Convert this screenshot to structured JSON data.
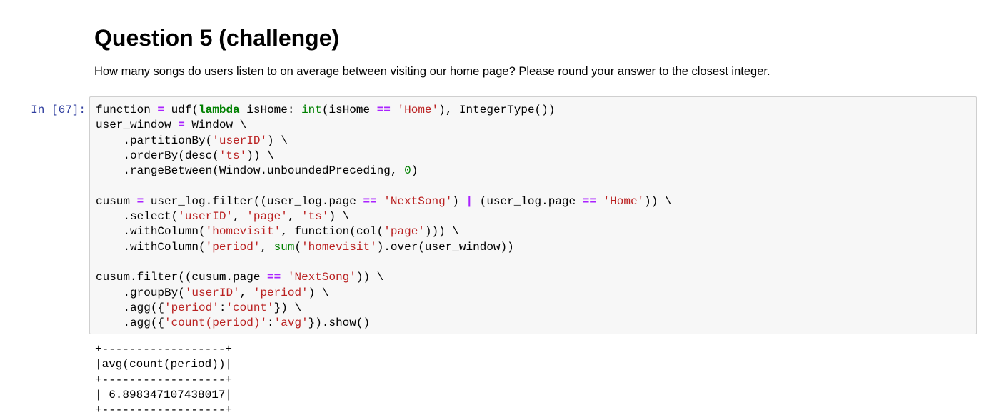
{
  "heading": "Question 5 (challenge)",
  "description": "How many songs do users listen to on average between visiting our home page? Please round your answer to the closest integer.",
  "cell": {
    "prompt": "In [67]:",
    "code_lines": [
      [
        [
          "t",
          "function "
        ],
        [
          "o",
          "="
        ],
        [
          "t",
          " udf("
        ],
        [
          "k",
          "lambda"
        ],
        [
          "t",
          " isHome: "
        ],
        [
          "b",
          "int"
        ],
        [
          "t",
          "(isHome "
        ],
        [
          "o",
          "=="
        ],
        [
          "t",
          " "
        ],
        [
          "s",
          "'Home'"
        ],
        [
          "t",
          "), IntegerType())"
        ]
      ],
      [
        [
          "t",
          "user_window "
        ],
        [
          "o",
          "="
        ],
        [
          "t",
          " Window \\"
        ]
      ],
      [
        [
          "t",
          "    .partitionBy("
        ],
        [
          "s",
          "'userID'"
        ],
        [
          "t",
          ") \\"
        ]
      ],
      [
        [
          "t",
          "    .orderBy(desc("
        ],
        [
          "s",
          "'ts'"
        ],
        [
          "t",
          ")) \\"
        ]
      ],
      [
        [
          "t",
          "    .rangeBetween(Window.unboundedPreceding, "
        ],
        [
          "n",
          "0"
        ],
        [
          "t",
          ")"
        ]
      ],
      [],
      [
        [
          "t",
          "cusum "
        ],
        [
          "o",
          "="
        ],
        [
          "t",
          " user_log.filter((user_log.page "
        ],
        [
          "o",
          "=="
        ],
        [
          "t",
          " "
        ],
        [
          "s",
          "'NextSong'"
        ],
        [
          "t",
          ") "
        ],
        [
          "o",
          "|"
        ],
        [
          "t",
          " (user_log.page "
        ],
        [
          "o",
          "=="
        ],
        [
          "t",
          " "
        ],
        [
          "s",
          "'Home'"
        ],
        [
          "t",
          ")) \\"
        ]
      ],
      [
        [
          "t",
          "    .select("
        ],
        [
          "s",
          "'userID'"
        ],
        [
          "t",
          ", "
        ],
        [
          "s",
          "'page'"
        ],
        [
          "t",
          ", "
        ],
        [
          "s",
          "'ts'"
        ],
        [
          "t",
          ") \\"
        ]
      ],
      [
        [
          "t",
          "    .withColumn("
        ],
        [
          "s",
          "'homevisit'"
        ],
        [
          "t",
          ", function(col("
        ],
        [
          "s",
          "'page'"
        ],
        [
          "t",
          "))) \\"
        ]
      ],
      [
        [
          "t",
          "    .withColumn("
        ],
        [
          "s",
          "'period'"
        ],
        [
          "t",
          ", "
        ],
        [
          "b",
          "sum"
        ],
        [
          "t",
          "("
        ],
        [
          "s",
          "'homevisit'"
        ],
        [
          "t",
          ").over(user_window))"
        ]
      ],
      [],
      [
        [
          "t",
          "cusum.filter((cusum.page "
        ],
        [
          "o",
          "=="
        ],
        [
          "t",
          " "
        ],
        [
          "s",
          "'NextSong'"
        ],
        [
          "t",
          ")) \\"
        ]
      ],
      [
        [
          "t",
          "    .groupBy("
        ],
        [
          "s",
          "'userID'"
        ],
        [
          "t",
          ", "
        ],
        [
          "s",
          "'period'"
        ],
        [
          "t",
          ") \\"
        ]
      ],
      [
        [
          "t",
          "    .agg({"
        ],
        [
          "s",
          "'period'"
        ],
        [
          "t",
          ":"
        ],
        [
          "s",
          "'count'"
        ],
        [
          "t",
          "}) \\"
        ]
      ],
      [
        [
          "t",
          "    .agg({"
        ],
        [
          "s",
          "'count(period)'"
        ],
        [
          "t",
          ":"
        ],
        [
          "s",
          "'avg'"
        ],
        [
          "t",
          "}).show()"
        ]
      ]
    ],
    "output_lines": [
      "+------------------+",
      "|avg(count(period))|",
      "+------------------+",
      "| 6.898347107438017|",
      "+------------------+"
    ]
  }
}
